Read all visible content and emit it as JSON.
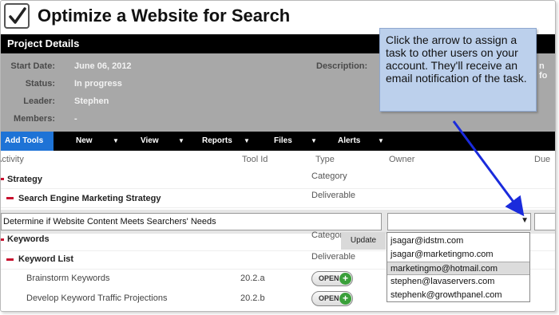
{
  "page": {
    "title": "Optimize a Website for Search"
  },
  "project": {
    "header": "Project Details",
    "fields": [
      {
        "label": "Start Date:",
        "value": "June 06, 2012"
      },
      {
        "label": "Status:",
        "value": "In progress"
      },
      {
        "label": "Leader:",
        "value": "Stephen"
      },
      {
        "label": "Members:",
        "value": "-"
      }
    ],
    "description_label": "Description:",
    "description_fragment": "n fo"
  },
  "toolbar": {
    "add_tools": "Add Tools",
    "menus": [
      "New",
      "View",
      "Reports",
      "Files",
      "Alerts"
    ]
  },
  "columns": {
    "activity": "Activity",
    "tool_id": "Tool Id",
    "type": "Type",
    "owner": "Owner",
    "due": "Due"
  },
  "rows": {
    "strategy": {
      "label": "Strategy",
      "type": "Category"
    },
    "sem_strategy": {
      "label": "Search Engine Marketing Strategy",
      "type": "Deliverable"
    },
    "keywords": {
      "label": "Keywords",
      "type": "Categor"
    },
    "keyword_list": {
      "label": "Keyword List",
      "type": "Deliverable"
    },
    "brainstorm": {
      "label": "Brainstorm Keywords",
      "tool_id": "20.2.a",
      "status": "OPEN"
    },
    "traffic": {
      "label": "Develop Keyword Traffic Projections",
      "tool_id": "20.2.b",
      "status": "OPEN"
    }
  },
  "edit": {
    "task_value": "Determine if Website Content Meets Searchers' Needs",
    "update_label": "Update"
  },
  "owner_options": [
    "jsagar@idstm.com",
    "jsagar@marketingmo.com",
    "marketingmo@hotmail.com",
    "stephen@lavaservers.com",
    "stephenk@growthpanel.com"
  ],
  "owner_selected_index": 2,
  "callout": {
    "text": "Click the arrow to assign a task to other users on your account. They'll receive an email notification of the task."
  },
  "colors": {
    "accent": "#1e73d6",
    "bar": "#000000",
    "details_bg": "#a8a8a8",
    "bullet": "#c8102e",
    "callout_bg": "#bcd0ec",
    "arrow": "#1a2bdc"
  },
  "icons": [
    "checkbox-check-icon",
    "dropdown-arrow-icon",
    "plus-circle-icon",
    "callout-arrow-icon"
  ]
}
